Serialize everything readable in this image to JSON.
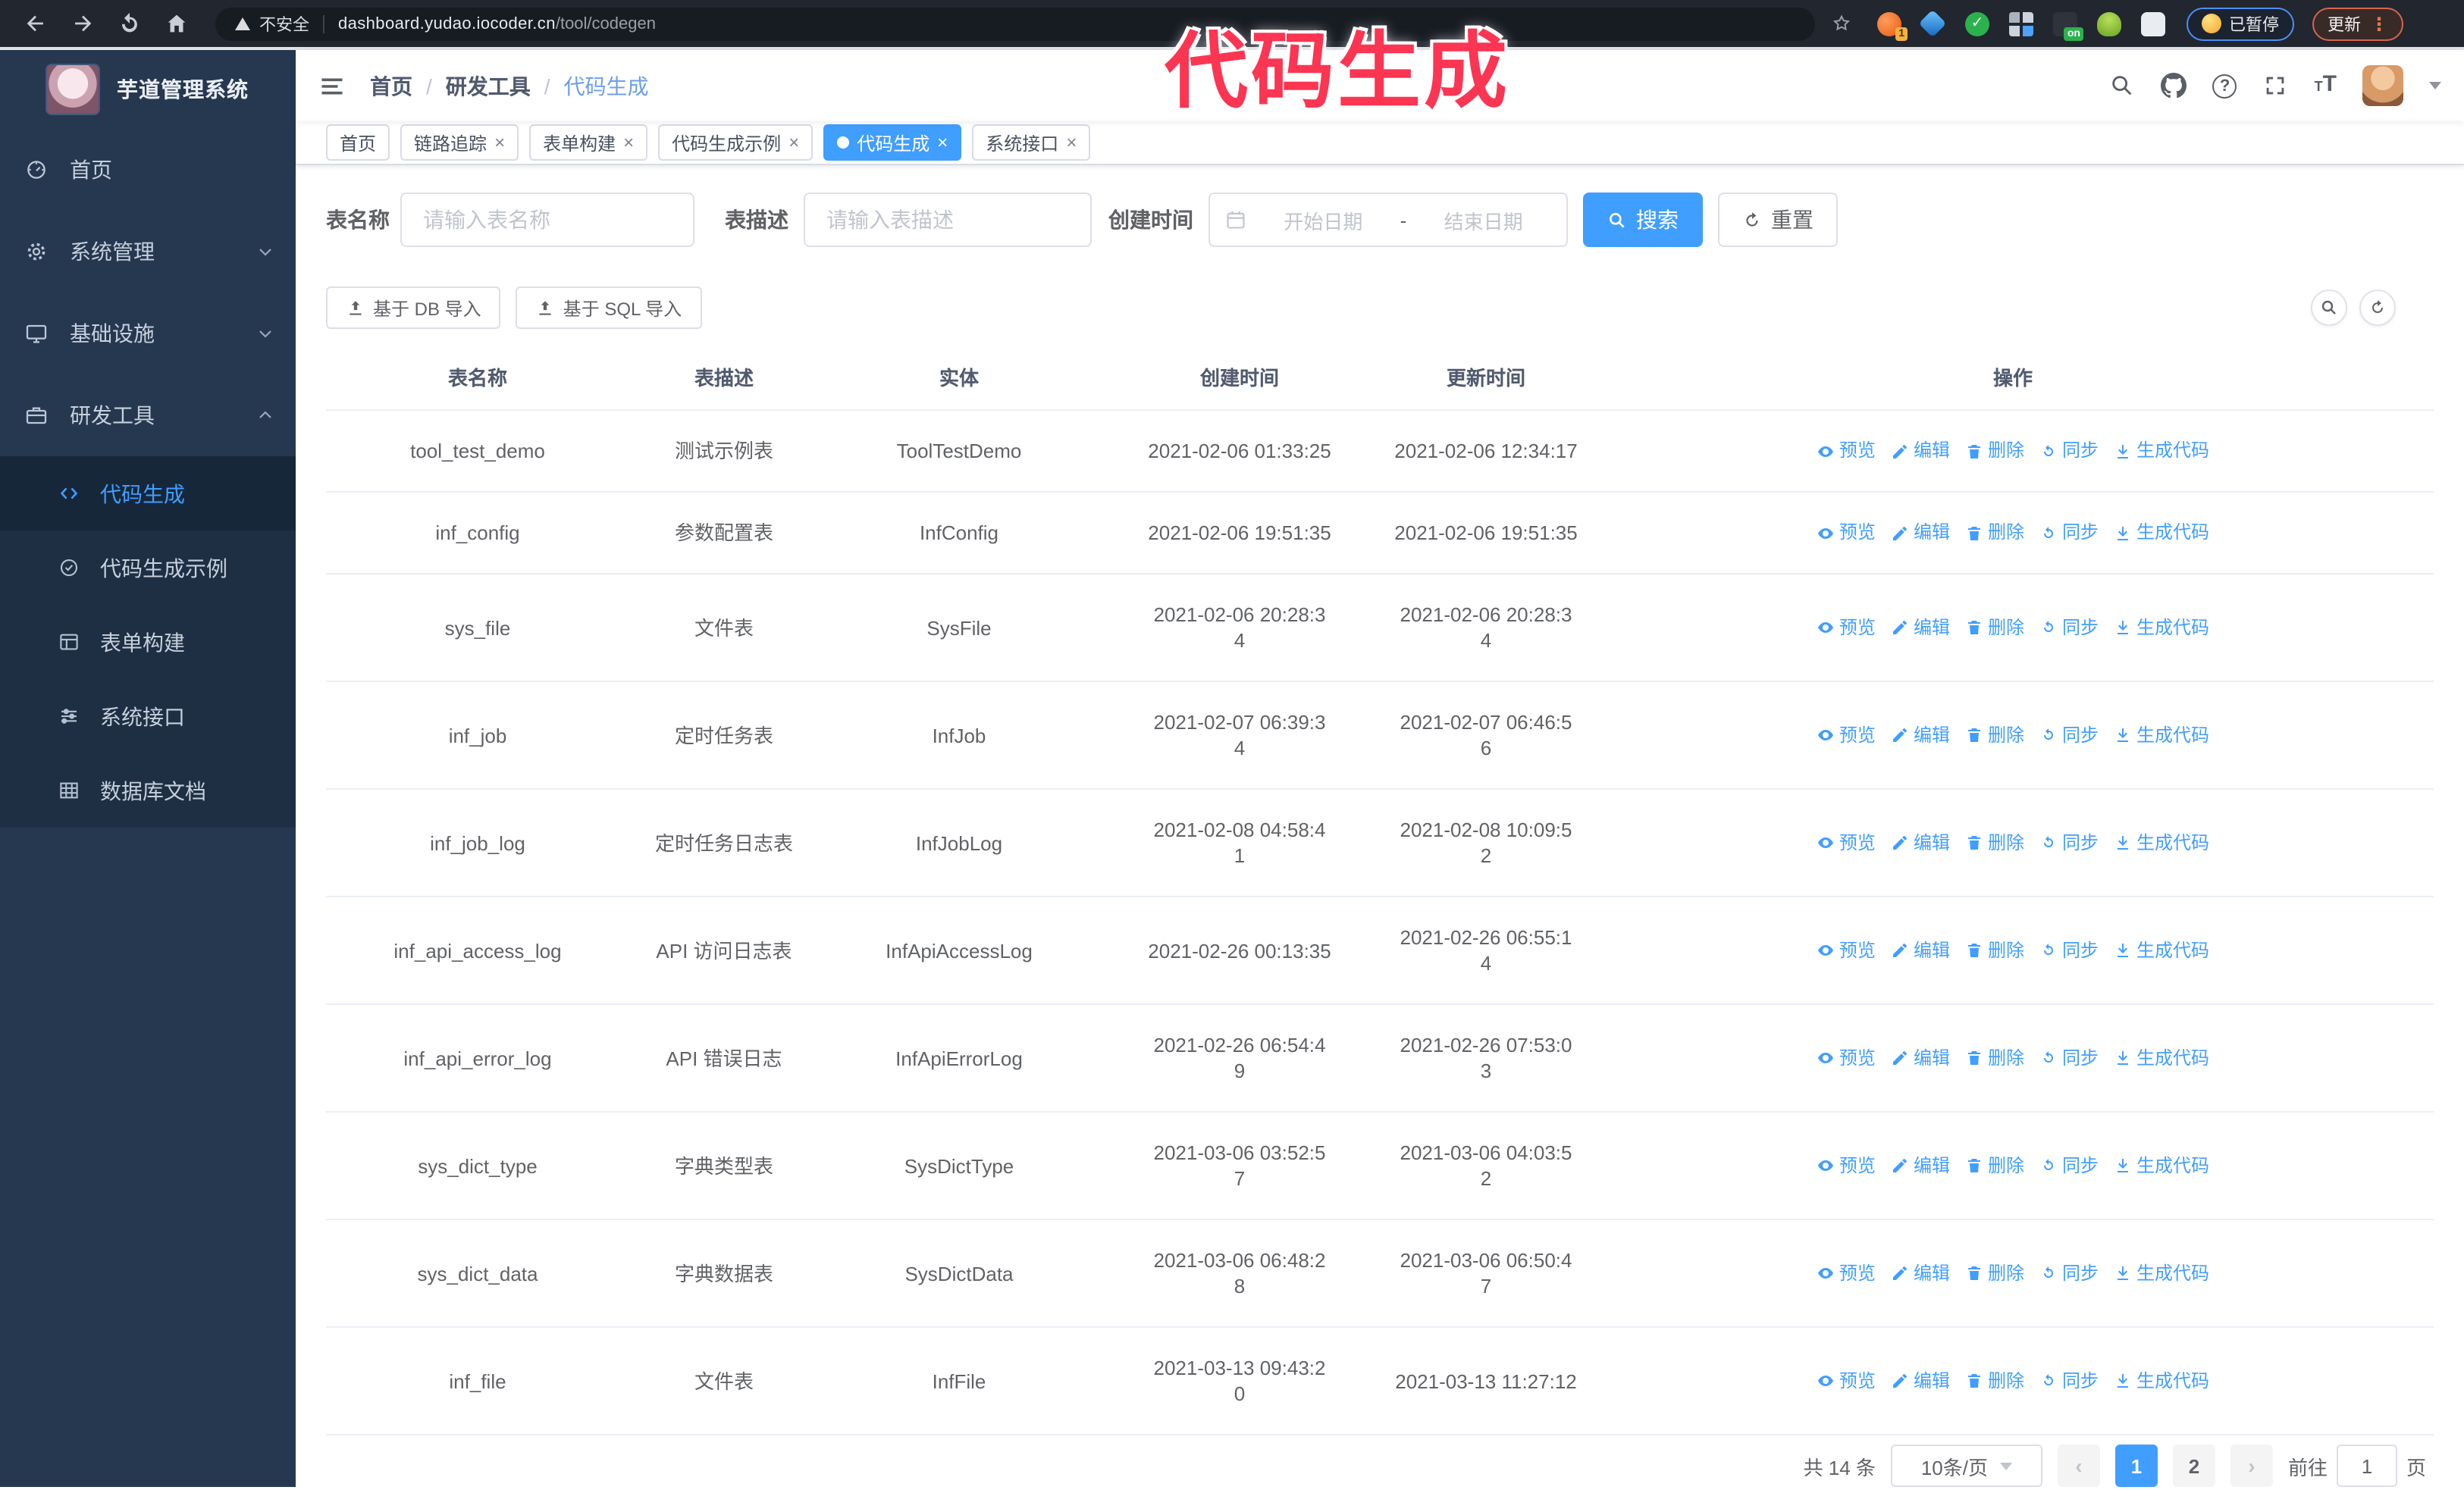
{
  "colors": {
    "primary": "#409EFF",
    "annotation": "#fb3552",
    "sidebar_bg": "#263850",
    "submenu_bg": "#1e2f44"
  },
  "annotation": {
    "title": "代码生成"
  },
  "browser": {
    "security_label": "不安全",
    "url_domain": "dashboard.yudao.iocoder.cn",
    "url_path": "/tool/codegen",
    "ext_badge_count": "1",
    "ext_badge_on": "on",
    "profile_chip": "已暂停",
    "update_button": "更新"
  },
  "sidebar": {
    "app_title": "芋道管理系统",
    "items": [
      {
        "label": "首页",
        "icon": "dashboard"
      },
      {
        "label": "系统管理",
        "icon": "gear",
        "chevron": "down"
      },
      {
        "label": "基础设施",
        "icon": "monitor",
        "chevron": "down"
      },
      {
        "label": "研发工具",
        "icon": "briefcase",
        "chevron": "up",
        "children": [
          {
            "label": "代码生成",
            "icon": "code",
            "active": true
          },
          {
            "label": "代码生成示例",
            "icon": "badge"
          },
          {
            "label": "表单构建",
            "icon": "form"
          },
          {
            "label": "系统接口",
            "icon": "sliders"
          },
          {
            "label": "数据库文档",
            "icon": "grid"
          }
        ]
      }
    ]
  },
  "breadcrumb": [
    "首页",
    "研发工具",
    "代码生成"
  ],
  "tabs": [
    {
      "label": "首页",
      "closable": false,
      "active": false
    },
    {
      "label": "链路追踪",
      "closable": true,
      "active": false
    },
    {
      "label": "表单构建",
      "closable": true,
      "active": false
    },
    {
      "label": "代码生成示例",
      "closable": true,
      "active": false
    },
    {
      "label": "代码生成",
      "closable": true,
      "active": true
    },
    {
      "label": "系统接口",
      "closable": true,
      "active": false
    }
  ],
  "filters": {
    "name_label": "表名称",
    "name_placeholder": "请输入表名称",
    "desc_label": "表描述",
    "desc_placeholder": "请输入表描述",
    "time_label": "创建时间",
    "start_placeholder": "开始日期",
    "range_separator": "-",
    "end_placeholder": "结束日期",
    "search_label": "搜索",
    "reset_label": "重置"
  },
  "toolbar": {
    "import_db": "基于 DB 导入",
    "import_sql": "基于 SQL 导入"
  },
  "table": {
    "columns": [
      "表名称",
      "表描述",
      "实体",
      "创建时间",
      "更新时间",
      "操作"
    ],
    "actions": [
      {
        "label": "预览",
        "icon": "eye"
      },
      {
        "label": "编辑",
        "icon": "edit"
      },
      {
        "label": "删除",
        "icon": "trash"
      },
      {
        "label": "同步",
        "icon": "sync"
      },
      {
        "label": "生成代码",
        "icon": "download"
      }
    ],
    "rows": [
      {
        "name": "tool_test_demo",
        "desc": "测试示例表",
        "entity": "ToolTestDemo",
        "created": "2021-02-06 01:33:25",
        "updated": "2021-02-06 12:34:17"
      },
      {
        "name": "inf_config",
        "desc": "参数配置表",
        "entity": "InfConfig",
        "created": "2021-02-06 19:51:35",
        "updated": "2021-02-06 19:51:35"
      },
      {
        "name": "sys_file",
        "desc": "文件表",
        "entity": "SysFile",
        "created": "2021-02-06 20:28:3\n4",
        "updated": "2021-02-06 20:28:3\n4"
      },
      {
        "name": "inf_job",
        "desc": "定时任务表",
        "entity": "InfJob",
        "created": "2021-02-07 06:39:3\n4",
        "updated": "2021-02-07 06:46:5\n6"
      },
      {
        "name": "inf_job_log",
        "desc": "定时任务日志表",
        "entity": "InfJobLog",
        "created": "2021-02-08 04:58:4\n1",
        "updated": "2021-02-08 10:09:5\n2"
      },
      {
        "name": "inf_api_access_log",
        "desc": "API 访问日志表",
        "entity": "InfApiAccessLog",
        "created": "2021-02-26 00:13:35",
        "updated": "2021-02-26 06:55:1\n4"
      },
      {
        "name": "inf_api_error_log",
        "desc": "API 错误日志",
        "entity": "InfApiErrorLog",
        "created": "2021-02-26 06:54:4\n9",
        "updated": "2021-02-26 07:53:0\n3"
      },
      {
        "name": "sys_dict_type",
        "desc": "字典类型表",
        "entity": "SysDictType",
        "created": "2021-03-06 03:52:5\n7",
        "updated": "2021-03-06 04:03:5\n2"
      },
      {
        "name": "sys_dict_data",
        "desc": "字典数据表",
        "entity": "SysDictData",
        "created": "2021-03-06 06:48:2\n8",
        "updated": "2021-03-06 06:50:4\n7"
      },
      {
        "name": "inf_file",
        "desc": "文件表",
        "entity": "InfFile",
        "created": "2021-03-13 09:43:2\n0",
        "updated": "2021-03-13 11:27:12"
      }
    ]
  },
  "pagination": {
    "total": "共 14 条",
    "page_size": "10条/页",
    "pages": [
      "1",
      "2"
    ],
    "active_page": "1",
    "prev": "‹",
    "next": "›",
    "goto_label": "前往",
    "goto_value": "1",
    "page_unit": "页"
  }
}
